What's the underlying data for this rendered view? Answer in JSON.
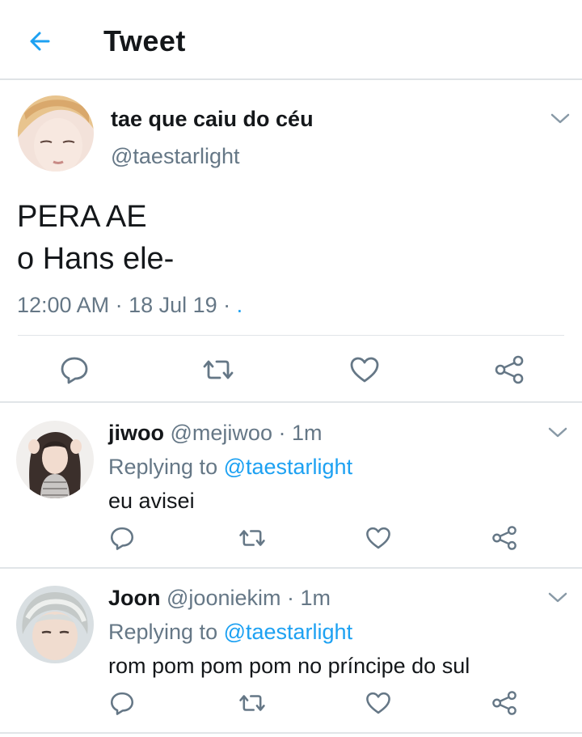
{
  "header": {
    "title": "Tweet",
    "back_icon": "arrow-left-icon",
    "accent": "#1da1f2"
  },
  "main_tweet": {
    "display_name": "tae que caiu do céu",
    "handle": "@taestarlight",
    "text_line1": "PERA AE",
    "text_line2": "o Hans ele-",
    "time": "12:00 AM",
    "separator1": " · ",
    "date": "18 Jul 19",
    "separator2": " · ",
    "trailing": ".",
    "actions": [
      "reply-icon",
      "retweet-icon",
      "like-icon",
      "share-icon"
    ]
  },
  "replies": [
    {
      "display_name": "jiwoo",
      "handle": "@mejiwoo",
      "time": "1m",
      "replying_prefix": "Replying to ",
      "replying_to": "@taestarlight",
      "text": "eu avisei"
    },
    {
      "display_name": "Joon",
      "handle": "@jooniekim",
      "time": "1m",
      "replying_prefix": "Replying to ",
      "replying_to": "@taestarlight",
      "text": "rom pom pom pom no príncipe do sul"
    }
  ],
  "colors": {
    "text": "#14171a",
    "secondary": "#657786",
    "link": "#1da1f2",
    "divider": "#e1e5e8"
  }
}
